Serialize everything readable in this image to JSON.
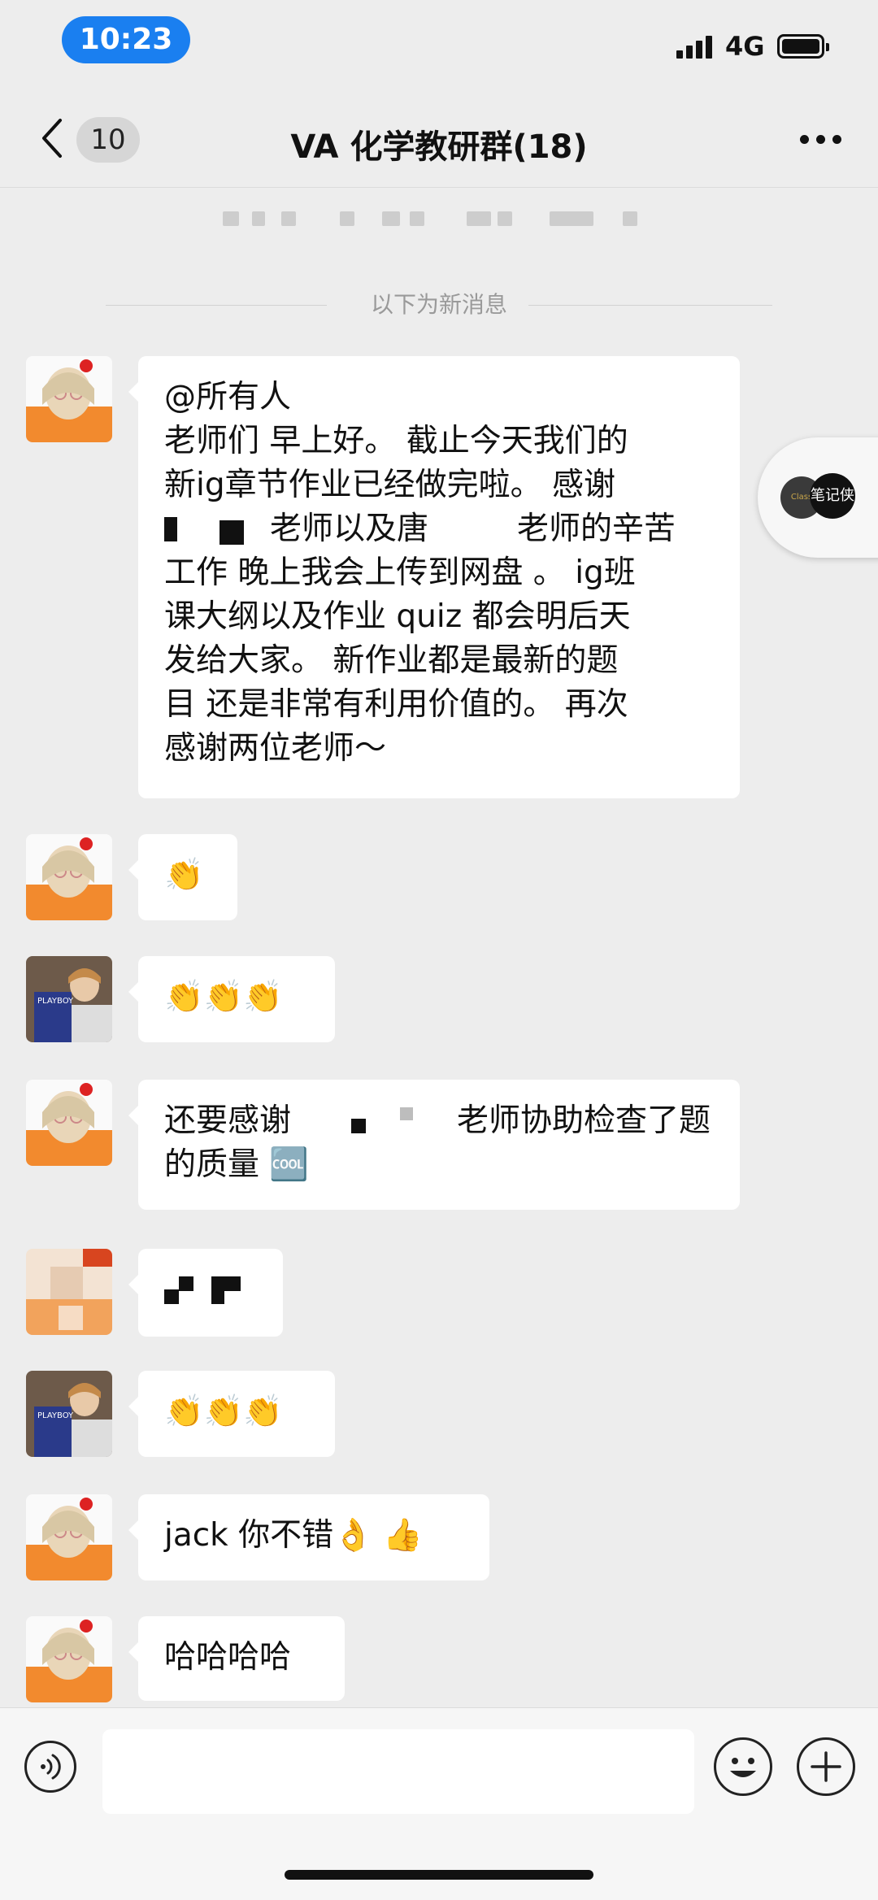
{
  "status_bar": {
    "time": "10:23",
    "network": "4G"
  },
  "nav": {
    "unread_count": "10",
    "title": "VA 化学教研群(18)"
  },
  "divider_text": "以下为新消息",
  "float_widget": {
    "label_1": "Class",
    "label_2": "笔记侠"
  },
  "messages": [
    {
      "lines": [
        "@所有人",
        "老师们 早上好。 截止今天我们的",
        "新ig章节作业已经做完啦。 感谢",
        "老师以及唐",
        "老师的辛苦",
        "工作 晚上我会上传到网盘 。 ig班",
        "课大纲以及作业 quiz 都会明后天",
        "发给大家。 新作业都是最新的题",
        "目 还是非常有利用价值的。 再次",
        "感谢两位老师～"
      ]
    },
    {
      "text": "👏"
    },
    {
      "text": "👏👏👏"
    },
    {
      "lines": [
        "还要感谢",
        "老师协助检查了题",
        "的质量 🆒"
      ]
    },
    {
      "text": ""
    },
    {
      "text": "👏👏👏"
    },
    {
      "text": "jack 你不错👌 👍"
    },
    {
      "text": "哈哈哈哈"
    }
  ],
  "icons": {
    "back": "chevron-left-icon",
    "more": "more-dots-icon",
    "voice": "voice-icon",
    "emoji": "emoji-icon",
    "plus": "plus-icon"
  }
}
